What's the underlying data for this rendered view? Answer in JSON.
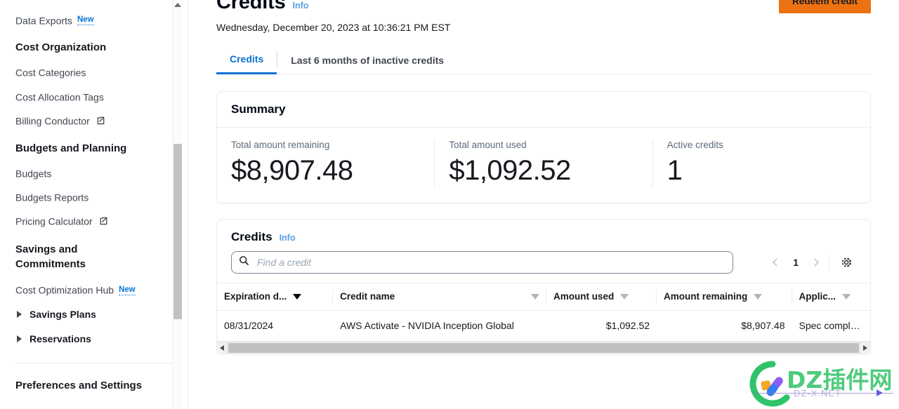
{
  "sidebar": {
    "items": [
      {
        "type": "link",
        "label": "Data Exports",
        "badge": "New",
        "external": false
      },
      {
        "type": "heading",
        "label": "Cost Organization"
      },
      {
        "type": "link",
        "label": "Cost Categories",
        "external": false
      },
      {
        "type": "link",
        "label": "Cost Allocation Tags",
        "external": false
      },
      {
        "type": "link",
        "label": "Billing Conductor",
        "external": true
      },
      {
        "type": "heading",
        "label": "Budgets and Planning"
      },
      {
        "type": "link",
        "label": "Budgets",
        "external": false
      },
      {
        "type": "link",
        "label": "Budgets Reports",
        "external": false
      },
      {
        "type": "link",
        "label": "Pricing Calculator",
        "external": true
      },
      {
        "type": "heading",
        "label": "Savings and Commitments"
      },
      {
        "type": "link",
        "label": "Cost Optimization Hub",
        "badge": "New",
        "external": false
      },
      {
        "type": "expandable",
        "label": "Savings Plans"
      },
      {
        "type": "expandable",
        "label": "Reservations"
      },
      {
        "type": "divider"
      },
      {
        "type": "heading",
        "label": "Preferences and Settings"
      }
    ]
  },
  "header": {
    "title": "Credits",
    "info_label": "Info",
    "timestamp": "Wednesday, December 20, 2023 at 10:36:21 PM EST",
    "redeem_button": "Redeem credit"
  },
  "tabs": [
    {
      "label": "Credits",
      "active": true
    },
    {
      "label": "Last 6 months of inactive credits",
      "active": false
    }
  ],
  "summary": {
    "title": "Summary",
    "metrics": [
      {
        "label": "Total amount remaining",
        "value": "$8,907.48"
      },
      {
        "label": "Total amount used",
        "value": "$1,092.52"
      },
      {
        "label": "Active credits",
        "value": "1"
      }
    ]
  },
  "credits_table": {
    "title": "Credits",
    "info_label": "Info",
    "search": {
      "placeholder": "Find a credit",
      "value": ""
    },
    "pagination": {
      "page": "1",
      "prev_icon": "chevron-left-icon",
      "next_icon": "chevron-right-icon"
    },
    "settings_icon": "gear-icon",
    "columns": [
      {
        "label": "Expiration d...",
        "sorted": true,
        "align": "left"
      },
      {
        "label": "Credit name",
        "sorted": false,
        "align": "left"
      },
      {
        "label": "Amount used",
        "sorted": false,
        "align": "right"
      },
      {
        "label": "Amount remaining",
        "sorted": false,
        "align": "right"
      },
      {
        "label": "Applic...",
        "sorted": false,
        "align": "left"
      }
    ],
    "rows": [
      {
        "expiration_date": "08/31/2024",
        "credit_name": "AWS Activate - NVIDIA Inception Global",
        "amount_used": "$1,092.52",
        "amount_remaining": "$8,907.48",
        "applicable_products": "Spec complete"
      }
    ]
  },
  "watermark": {
    "text": "DZ插件网",
    "subtext": "DZ-X.NET"
  },
  "colors": {
    "accent_blue": "#0972d3",
    "link_blue": "#539fe5",
    "button_orange": "#ec7211",
    "border_gray": "#e9ebed",
    "text_secondary": "#5f6b7a",
    "watermark_green": "#36c46a"
  }
}
